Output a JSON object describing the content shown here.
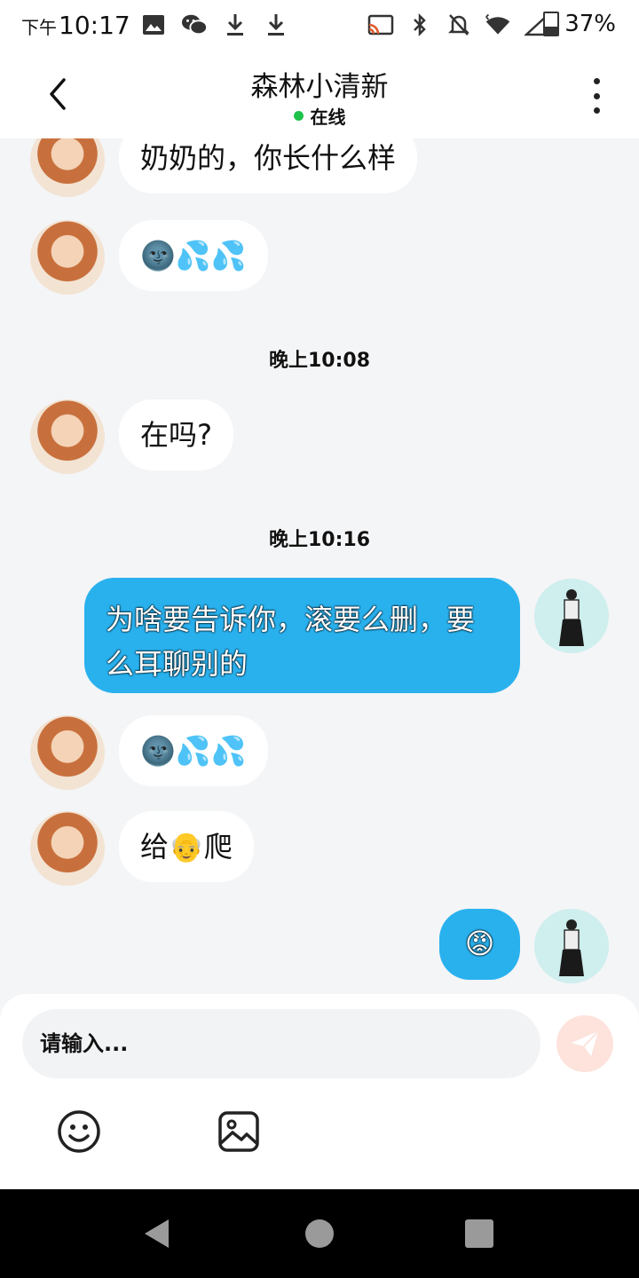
{
  "status_bar": {
    "ampm": "下午",
    "time": "10:17",
    "battery": "37%",
    "icons": [
      "image-icon",
      "wechat-icon",
      "download-icon",
      "download-icon",
      "cast-icon",
      "bluetooth-icon",
      "bell-off-icon",
      "wifi-icon",
      "signal-icon"
    ]
  },
  "header": {
    "title": "森林小清新",
    "status": "在线"
  },
  "messages": [
    {
      "side": "peer",
      "text": "奶奶的，你长什么样"
    },
    {
      "side": "peer",
      "text": "🌚💦💦"
    },
    {
      "side": "time",
      "text": "晚上10:08"
    },
    {
      "side": "peer",
      "text": "在吗?"
    },
    {
      "side": "time",
      "text": "晚上10:16"
    },
    {
      "side": "self",
      "line1": "为啥要告诉你，滚要么删，要",
      "line2": "么耳聊别的"
    },
    {
      "side": "peer",
      "text": "🌚💦💦"
    },
    {
      "side": "peer",
      "text": "给👴爬"
    },
    {
      "side": "self",
      "text": "😡"
    }
  ],
  "composer": {
    "placeholder": "请输入..."
  },
  "colors": {
    "self_bubble": "#29b1ee",
    "peer_bubble": "#ffffff",
    "online": "#1fc24a",
    "send_disabled": "#fde3dc"
  }
}
